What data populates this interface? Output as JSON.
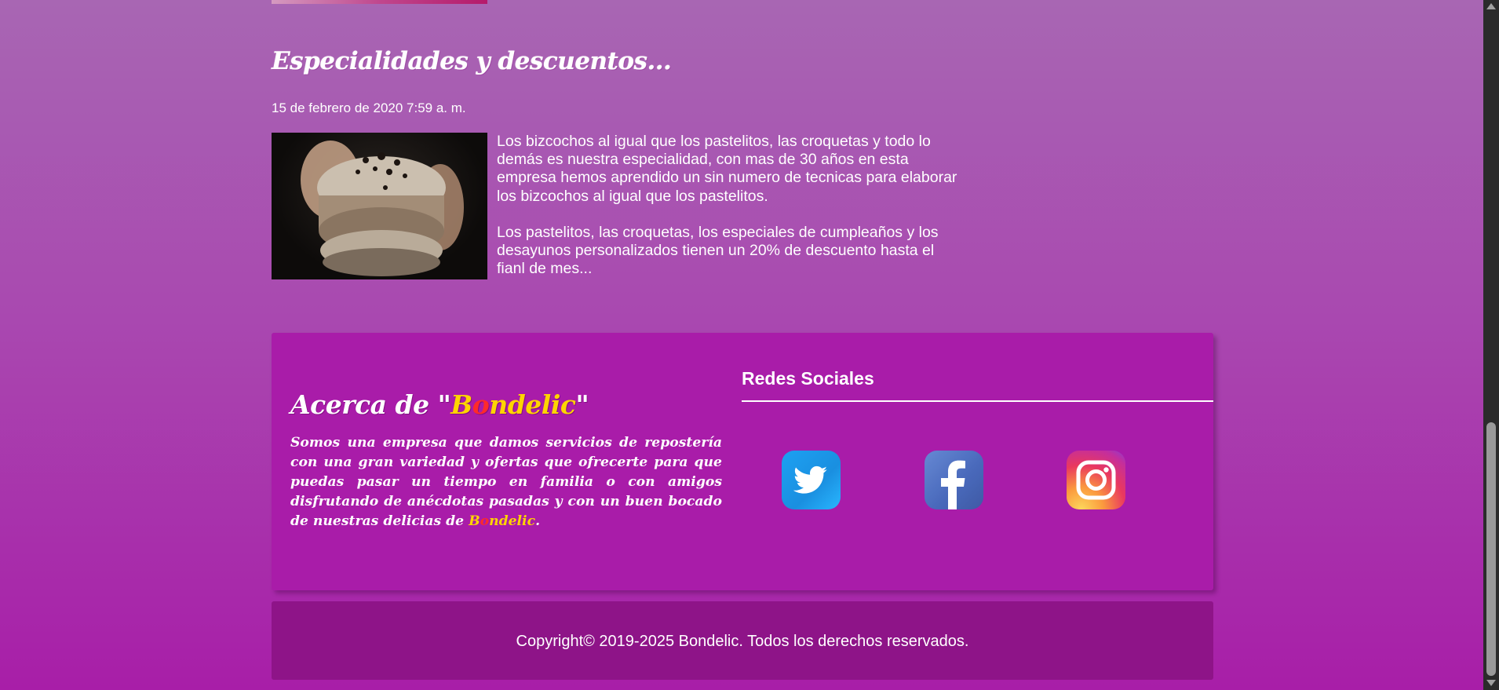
{
  "post": {
    "title": "Especialidades y descuentos...",
    "date": "15 de febrero de 2020 7:59 a. m.",
    "paragraphs": [
      "Los bizcochos al igual que los pastelitos, las croquetas y todo lo demás es nuestra especialidad, con mas de 30 años en esta empresa hemos aprendido un sin numero de tecnicas para elaborar los bizcochos al igual que los pastelitos.",
      "Los pastelitos, las croquetas, los especiales de cumpleaños y los desayunos personalizados tienen un 20% de descuento hasta el fianl de mes..."
    ]
  },
  "about": {
    "title_prefix": "Acerca de \"",
    "brand_first": "B",
    "brand_o": "o",
    "brand_rest": "ndelic",
    "title_suffix": "\"",
    "text": "Somos una empresa que damos servicios de repostería con una gran variedad y ofertas que ofrecerte para que puedas pasar un tiempo en familia o con amigos disfrutando de anécdotas pasadas y con un buen bocado de nuestras delicias de ",
    "text_end": "."
  },
  "social": {
    "title": "Redes Sociales",
    "icons": [
      "twitter-icon",
      "facebook-icon",
      "instagram-icon"
    ]
  },
  "footer": {
    "copyright": "Copyright© 2019-2025 Bondelic. Todos los derechos reservados."
  },
  "colors": {
    "brand_yellow": "#ffd400",
    "brand_red": "#ff2a2a",
    "panel": "#a91ca9",
    "footer": "#8e1488"
  }
}
